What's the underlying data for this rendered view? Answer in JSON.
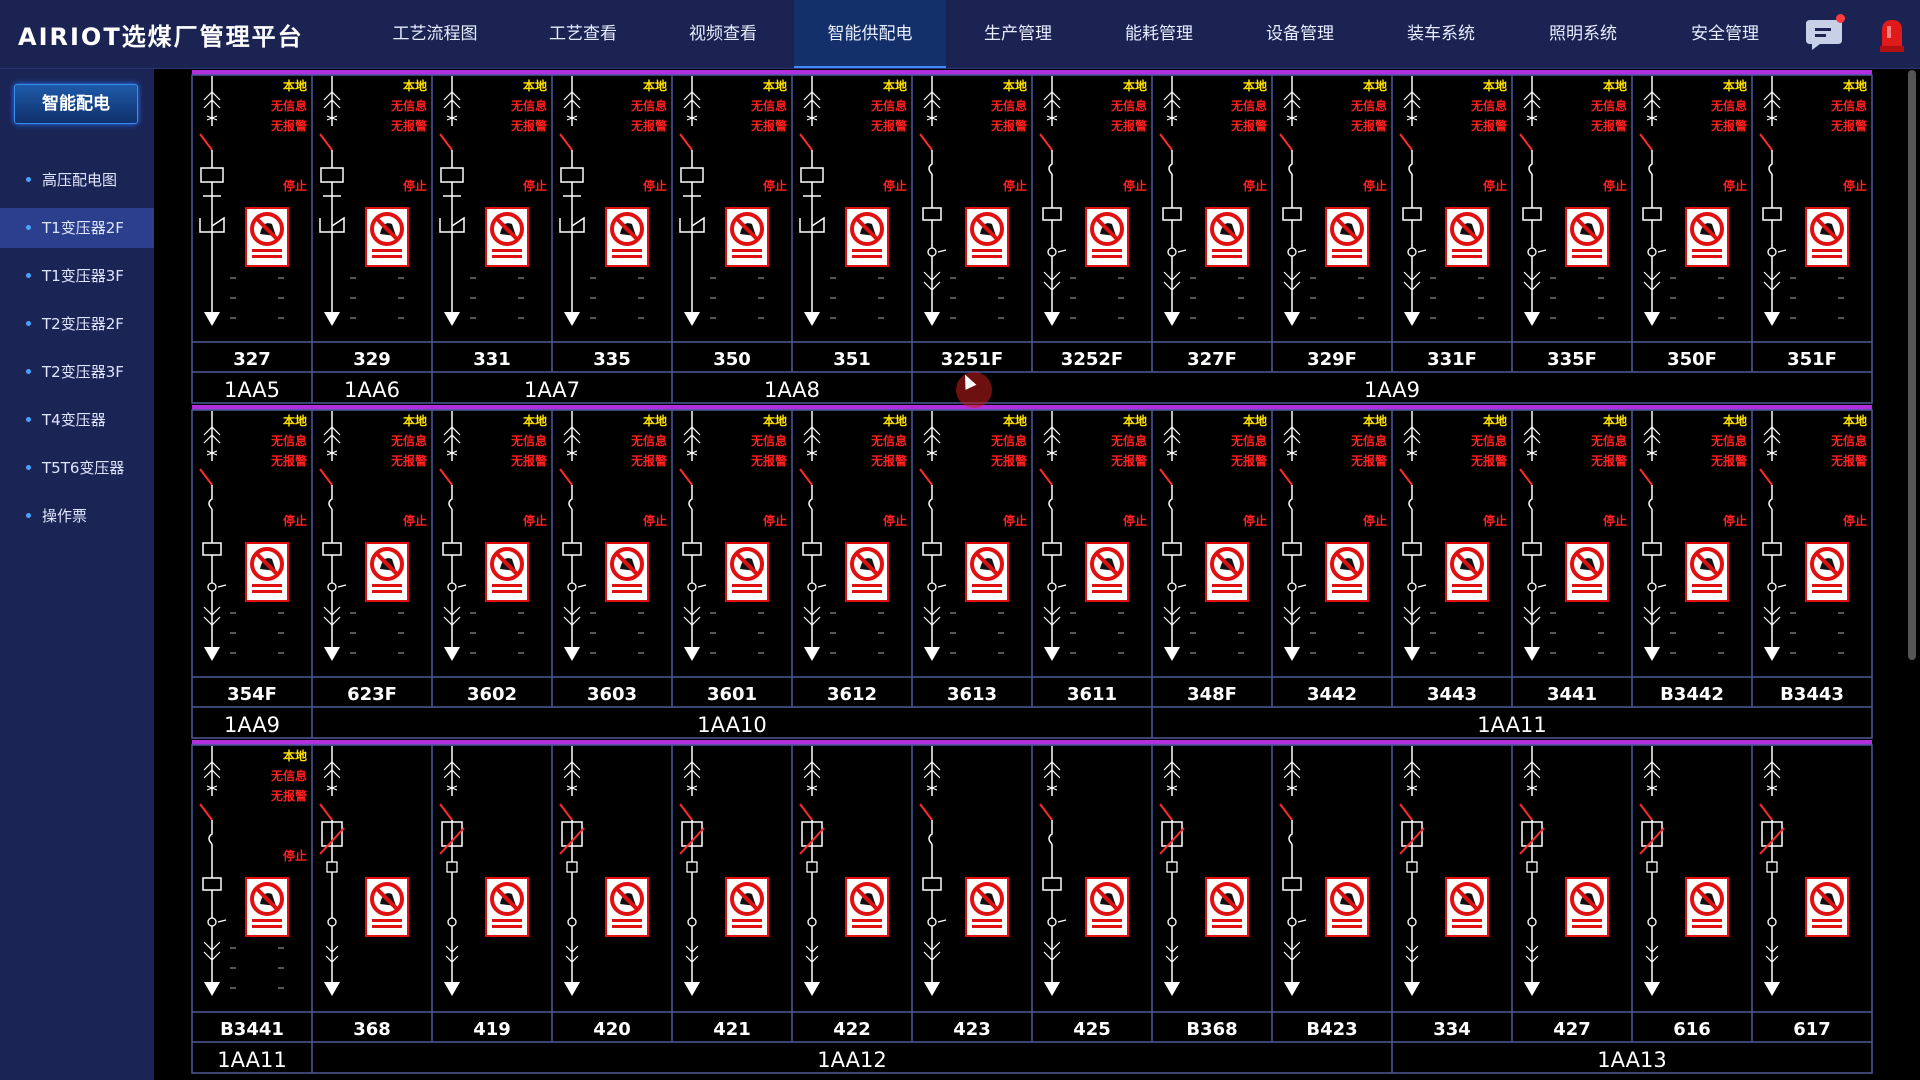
{
  "app": {
    "title": "AIRIOT选煤厂管理平台"
  },
  "nav": {
    "items": [
      "工艺流程图",
      "工艺查看",
      "视频查看",
      "智能供配电",
      "生产管理",
      "能耗管理",
      "设备管理",
      "装车系统",
      "照明系统",
      "安全管理"
    ],
    "active_index": 3
  },
  "icons": {
    "chat": "chat-icon",
    "alarm": "alarm-light-icon",
    "sign": "no-closing-sign-icon"
  },
  "sidebar": {
    "title": "智能配电",
    "items": [
      "高压配电图",
      "T1变压器2F",
      "T1变压器3F",
      "T2变压器2F",
      "T2变压器3F",
      "T4变压器",
      "T5T6变压器",
      "操作票"
    ],
    "active_index": 1
  },
  "status_text": {
    "local": "本地",
    "no_info": "无信息",
    "no_alarm": "无报警",
    "stop": "停止",
    "sign": "禁止合闸有人工作"
  },
  "colors": {
    "background": "#000000",
    "bus": "#b030e0",
    "grid": "#4a5a9a",
    "local": "#ffe000",
    "alarm": "#ff2020",
    "sign_red": "#e01010",
    "header": "#1a2352",
    "sidebar": "#1a2455"
  },
  "rows": [
    {
      "bays": [
        {
          "id": "327",
          "type": "drawout",
          "status": true
        },
        {
          "id": "329",
          "type": "drawout",
          "status": true
        },
        {
          "id": "331",
          "type": "drawout",
          "status": true
        },
        {
          "id": "335",
          "type": "drawout",
          "status": true
        },
        {
          "id": "350",
          "type": "drawout",
          "status": true
        },
        {
          "id": "351",
          "type": "drawout",
          "status": true
        },
        {
          "id": "3251F",
          "type": "breaker",
          "status": true
        },
        {
          "id": "3252F",
          "type": "breaker",
          "status": true
        },
        {
          "id": "327F",
          "type": "breaker",
          "status": true
        },
        {
          "id": "329F",
          "type": "breaker",
          "status": true
        },
        {
          "id": "331F",
          "type": "breaker",
          "status": true
        },
        {
          "id": "335F",
          "type": "breaker",
          "status": true
        },
        {
          "id": "350F",
          "type": "breaker",
          "status": true
        },
        {
          "id": "351F",
          "type": "breaker",
          "status": true
        }
      ],
      "groups": [
        {
          "label": "1AA5",
          "span": 1
        },
        {
          "label": "1AA6",
          "span": 1
        },
        {
          "label": "1AA7",
          "span": 2
        },
        {
          "label": "1AA8",
          "span": 2
        },
        {
          "label": "1AA9",
          "span": 8
        }
      ]
    },
    {
      "bays": [
        {
          "id": "354F",
          "type": "breaker",
          "status": true
        },
        {
          "id": "623F",
          "type": "breaker",
          "status": true
        },
        {
          "id": "3602",
          "type": "breaker",
          "status": true
        },
        {
          "id": "3603",
          "type": "breaker",
          "status": true
        },
        {
          "id": "3601",
          "type": "breaker",
          "status": true
        },
        {
          "id": "3612",
          "type": "breaker",
          "status": true
        },
        {
          "id": "3613",
          "type": "breaker",
          "status": true
        },
        {
          "id": "3611",
          "type": "breaker",
          "status": true
        },
        {
          "id": "348F",
          "type": "breaker",
          "status": true
        },
        {
          "id": "3442",
          "type": "breaker",
          "status": true
        },
        {
          "id": "3443",
          "type": "breaker",
          "status": true
        },
        {
          "id": "3441",
          "type": "breaker",
          "status": true
        },
        {
          "id": "B3442",
          "type": "breaker",
          "status": true
        },
        {
          "id": "B3443",
          "type": "breaker",
          "status": true
        }
      ],
      "groups": [
        {
          "label": "1AA9",
          "span": 1
        },
        {
          "label": "1AA10",
          "span": 7
        },
        {
          "label": "1AA11",
          "span": 6
        }
      ]
    },
    {
      "bays": [
        {
          "id": "B3441",
          "type": "breaker",
          "status": true
        },
        {
          "id": "368",
          "type": "fuse",
          "status": false
        },
        {
          "id": "419",
          "type": "fuse",
          "status": false
        },
        {
          "id": "420",
          "type": "fuse",
          "status": false
        },
        {
          "id": "421",
          "type": "fuse",
          "status": false
        },
        {
          "id": "422",
          "type": "fuse",
          "status": false
        },
        {
          "id": "423",
          "type": "breaker",
          "status": false
        },
        {
          "id": "425",
          "type": "breaker",
          "status": false
        },
        {
          "id": "B368",
          "type": "fuse",
          "status": false
        },
        {
          "id": "B423",
          "type": "breaker",
          "status": false
        },
        {
          "id": "334",
          "type": "fuse",
          "status": false
        },
        {
          "id": "427",
          "type": "fuse",
          "status": false
        },
        {
          "id": "616",
          "type": "fuse",
          "status": false
        },
        {
          "id": "617",
          "type": "fuse",
          "status": false
        }
      ],
      "groups": [
        {
          "label": "1AA11",
          "span": 1
        },
        {
          "label": "1AA12",
          "span": 9
        },
        {
          "label": "1AA13",
          "span": 4
        }
      ]
    }
  ]
}
